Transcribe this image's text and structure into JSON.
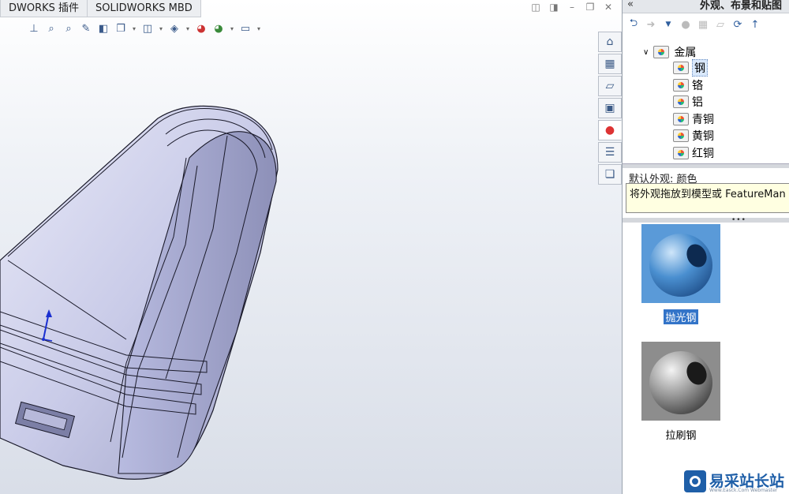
{
  "tabs": [
    {
      "label": "DWORKS 插件"
    },
    {
      "label": "SOLIDWORKS MBD"
    }
  ],
  "toolbar_icons": [
    "view-orientation-icon",
    "zoom-to-fit-icon",
    "zoom-area-icon",
    "previous-view-icon",
    "section-view-icon",
    "display-style-icon",
    "view-cube-icon",
    "hide-show-icon",
    "edit-appearance-icon",
    "apply-scene-icon",
    "view-settings-icon"
  ],
  "window_controls": [
    "restore-icon",
    "tile-icon",
    "minimize-icon",
    "maximize-icon",
    "close-icon"
  ],
  "task_pane": {
    "collapse_glyph": "«",
    "title": "外观、布景和贴图",
    "nav_icons": [
      "back-icon",
      "forward-icon",
      "dropdown-icon",
      "appearance-icon",
      "model-icon",
      "folder-icon",
      "refresh-icon",
      "up-icon"
    ],
    "side_tabs": [
      "home-icon",
      "design-library-icon",
      "file-explorer-icon",
      "view-palette-icon",
      "appearances-icon",
      "custom-properties-icon",
      "forum-icon"
    ],
    "tree": {
      "root": "金属",
      "items": [
        {
          "label": "钢",
          "selected": true
        },
        {
          "label": "铬",
          "selected": false
        },
        {
          "label": "铝",
          "selected": false
        },
        {
          "label": "青铜",
          "selected": false
        },
        {
          "label": "黄铜",
          "selected": false
        },
        {
          "label": "红铜",
          "selected": false
        }
      ]
    },
    "info_label": "默认外观: 颜色",
    "tooltip": "将外观拖放到模型或 FeatureMan",
    "swatches": [
      {
        "label": "抛光钢",
        "selected": true,
        "color": "#4a8fd0"
      },
      {
        "label": "拉刷钢",
        "selected": false,
        "color": "#9a9a9a"
      }
    ]
  },
  "watermark": {
    "text": "易采站长站",
    "sub": "Www.Easck.Com Webmaster"
  },
  "colors": {
    "model_fill": "#c9cbe8",
    "model_edge": "#1a1a2a",
    "accent": "#3374c8"
  }
}
